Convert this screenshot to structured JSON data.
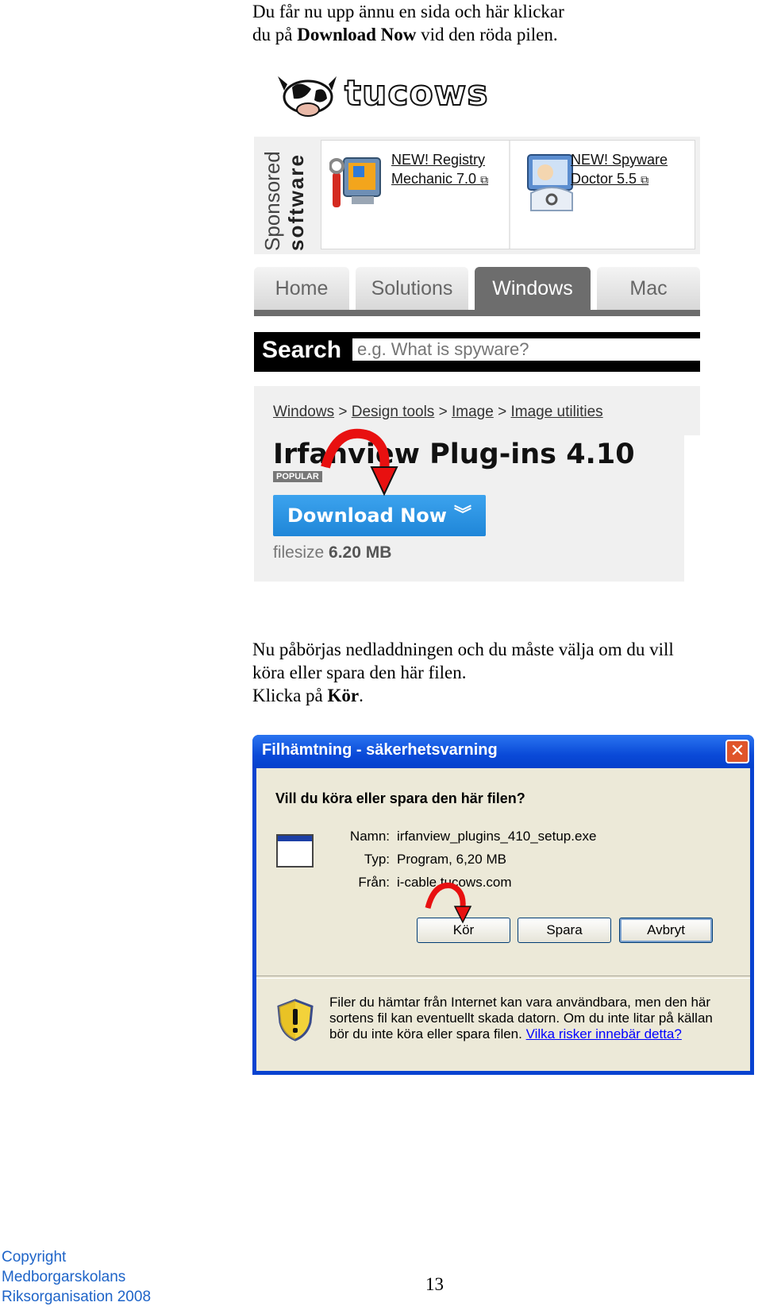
{
  "intro": {
    "line1": "Du får nu upp ännu en sida och här klickar",
    "line2_pre": "du på ",
    "line2_bold": "Download Now",
    "line2_post": " vid den röda pilen."
  },
  "tucows": {
    "logo": "tucows",
    "sponsored_top": "Sponsored",
    "sponsored_bottom": "software",
    "ad1": [
      "NEW! Registry",
      "Mechanic 7.0"
    ],
    "ad2": [
      "NEW! Spyware",
      "Doctor 5.5"
    ],
    "tabs": [
      "Home",
      "Solutions",
      "Windows",
      "Mac"
    ],
    "active_tab": "Windows",
    "search_label": "Search",
    "search_placeholder": "e.g. What is spyware?",
    "breadcrumbs": [
      "Windows",
      "Design tools",
      "Image",
      "Image utilities"
    ],
    "breadcrumb_sep": ">",
    "product_title": "Irfanview Plug-ins 4.10",
    "popular_badge": "POPULAR",
    "download_label": "Download Now",
    "filesize_label": "filesize",
    "filesize_value": "6.20 MB"
  },
  "middle": {
    "line1": "Nu påbörjas nedladdningen och du måste välja om du vill",
    "line2": "köra eller spara den här filen.",
    "line3_pre": "Klicka på ",
    "line3_bold": "Kör",
    "line3_post": "."
  },
  "dialog": {
    "title": "Filhämtning - säkerhetsvarning",
    "question": "Vill du köra eller spara den här filen?",
    "name_label": "Namn:",
    "name_value": "irfanview_plugins_410_setup.exe",
    "type_label": "Typ:",
    "type_value": "Program, 6,20 MB",
    "from_label": "Från:",
    "from_value": "i-cable.tucows.com",
    "btn_run": "Kör",
    "btn_save": "Spara",
    "btn_cancel": "Avbryt",
    "warning": "Filer du hämtar från Internet kan vara användbara, men den här sortens fil kan eventuellt skada datorn. Om du inte litar på källan bör du inte köra eller spara filen.",
    "warning_link": "Vilka risker innebär detta?"
  },
  "footer": {
    "line1": "Copyright",
    "line2": "Medborgarskolans",
    "line3": "Riksorganisation 2008",
    "page_number": "13"
  },
  "colors": {
    "download_button": "#2a93e4",
    "xp_titlebar": "#0a4ad8",
    "arrow_red": "#e81010",
    "footer_blue": "#1e64c8"
  }
}
